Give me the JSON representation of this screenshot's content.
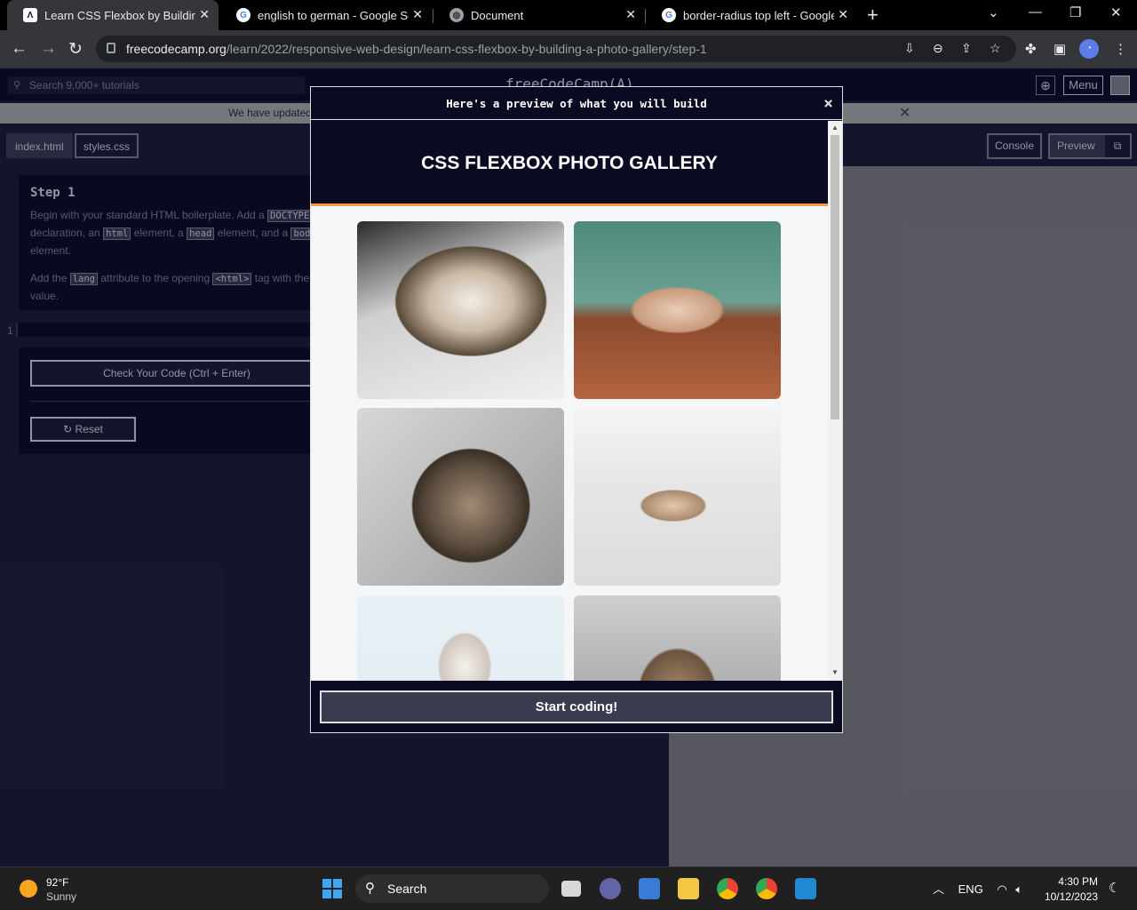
{
  "browser": {
    "tabs": [
      {
        "title": "Learn CSS Flexbox by Building a",
        "icon": "freecodecamp-icon",
        "active": true
      },
      {
        "title": "english to german - Google Sear",
        "icon": "google-icon",
        "active": false
      },
      {
        "title": "Document",
        "icon": "globe-icon",
        "active": false
      },
      {
        "title": "border-radius top left - Google S",
        "icon": "google-icon",
        "active": false
      }
    ],
    "url_host": "freecodecamp.org",
    "url_path": "/learn/2022/responsive-web-design/learn-css-flexbox-by-building-a-photo-gallery/step-1"
  },
  "fcc": {
    "search_placeholder": "Search 9,000+ tutorials",
    "logo": "freeCodeCamp(A)",
    "menu_label": "Menu",
    "banner_text": "We have updated",
    "file_tabs": [
      "index.html",
      "styles.css"
    ],
    "step_title": "Step 1",
    "instr_p1_a": "Begin with your standard HTML boilerplate. Add a",
    "instr_code_doctype": "DOCTYPE",
    "instr_p1_b": "declaration, an",
    "instr_code_html": "html",
    "instr_p1_c": "element, a",
    "instr_code_head": "head",
    "instr_p1_d": "element, and a",
    "instr_code_body": "bod",
    "instr_p1_e": "element.",
    "instr_p2_a": "Add the",
    "instr_code_lang": "lang",
    "instr_p2_b": "attribute to the opening",
    "instr_code_htmltag": "<html>",
    "instr_p2_c": "tag with",
    "instr_p2_d": "the value.",
    "line_number": "1",
    "check_button": "Check Your Code (Ctrl + Enter)",
    "reset_button": "Reset",
    "console_button": "Console",
    "preview_button": "Preview"
  },
  "modal": {
    "header": "Here's a preview of what you will build",
    "close": "×",
    "gallery_title": "CSS FLEXBOX PHOTO GALLERY",
    "start_button": "Start coding!"
  },
  "taskbar": {
    "temperature": "92°F",
    "condition": "Sunny",
    "search_label": "Search",
    "language": "ENG",
    "time": "4:30 PM",
    "date": "10/12/2023"
  },
  "colors": {
    "fcc_bg": "#0a0a23",
    "accent_orange": "#ff9b3d",
    "banner_green": "#aeb4a9"
  }
}
